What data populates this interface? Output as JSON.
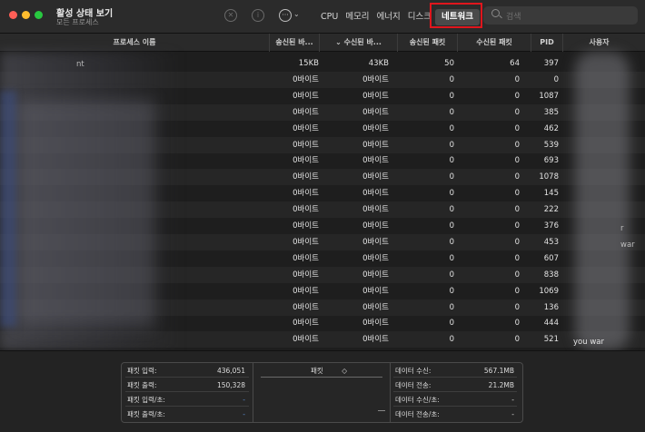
{
  "window": {
    "title": "활성 상태 보기",
    "subtitle": "모든 프로세스"
  },
  "toolbar": {
    "stop_glyph": "✕",
    "info_glyph": "i",
    "more_glyph": "···",
    "chevron_glyph": "⌄"
  },
  "tabs": [
    {
      "label": "CPU",
      "active": false
    },
    {
      "label": "메모리",
      "active": false
    },
    {
      "label": "에너지",
      "active": false
    },
    {
      "label": "디스크",
      "active": false
    },
    {
      "label": "네트워크",
      "active": true
    }
  ],
  "search": {
    "placeholder": "검색"
  },
  "columns": [
    "프로세스 이름",
    "송신된 바...",
    "수신된 바...",
    "송신된 패킷",
    "수신된 패킷",
    "PID",
    "사용자"
  ],
  "sort_indicator": "⌄",
  "rows": [
    {
      "name_fragment": "nt",
      "sent_bytes": "15KB",
      "recv_bytes": "43KB",
      "sent_packets": "50",
      "recv_packets": "64",
      "pid": "397"
    },
    {
      "sent_bytes": "0바이트",
      "recv_bytes": "0바이트",
      "sent_packets": "0",
      "recv_packets": "0",
      "pid": "0"
    },
    {
      "sent_bytes": "0바이트",
      "recv_bytes": "0바이트",
      "sent_packets": "0",
      "recv_packets": "0",
      "pid": "1087"
    },
    {
      "sent_bytes": "0바이트",
      "recv_bytes": "0바이트",
      "sent_packets": "0",
      "recv_packets": "0",
      "pid": "385"
    },
    {
      "sent_bytes": "0바이트",
      "recv_bytes": "0바이트",
      "sent_packets": "0",
      "recv_packets": "0",
      "pid": "462"
    },
    {
      "sent_bytes": "0바이트",
      "recv_bytes": "0바이트",
      "sent_packets": "0",
      "recv_packets": "0",
      "pid": "539"
    },
    {
      "sent_bytes": "0바이트",
      "recv_bytes": "0바이트",
      "sent_packets": "0",
      "recv_packets": "0",
      "pid": "693"
    },
    {
      "sent_bytes": "0바이트",
      "recv_bytes": "0바이트",
      "sent_packets": "0",
      "recv_packets": "0",
      "pid": "1078"
    },
    {
      "sent_bytes": "0바이트",
      "recv_bytes": "0바이트",
      "sent_packets": "0",
      "recv_packets": "0",
      "pid": "145"
    },
    {
      "sent_bytes": "0바이트",
      "recv_bytes": "0바이트",
      "sent_packets": "0",
      "recv_packets": "0",
      "pid": "222"
    },
    {
      "sent_bytes": "0바이트",
      "recv_bytes": "0바이트",
      "sent_packets": "0",
      "recv_packets": "0",
      "pid": "376"
    },
    {
      "sent_bytes": "0바이트",
      "recv_bytes": "0바이트",
      "sent_packets": "0",
      "recv_packets": "0",
      "pid": "453"
    },
    {
      "sent_bytes": "0바이트",
      "recv_bytes": "0바이트",
      "sent_packets": "0",
      "recv_packets": "0",
      "pid": "607"
    },
    {
      "sent_bytes": "0바이트",
      "recv_bytes": "0바이트",
      "sent_packets": "0",
      "recv_packets": "0",
      "pid": "838"
    },
    {
      "sent_bytes": "0바이트",
      "recv_bytes": "0바이트",
      "sent_packets": "0",
      "recv_packets": "0",
      "pid": "1069"
    },
    {
      "sent_bytes": "0바이트",
      "recv_bytes": "0바이트",
      "sent_packets": "0",
      "recv_packets": "0",
      "pid": "136"
    },
    {
      "sent_bytes": "0바이트",
      "recv_bytes": "0바이트",
      "sent_packets": "0",
      "recv_packets": "0",
      "pid": "444"
    },
    {
      "sent_bytes": "0바이트",
      "recv_bytes": "0바이트",
      "sent_packets": "0",
      "recv_packets": "0",
      "pid": "521"
    }
  ],
  "user_fragments": {
    "last_row": "you        war",
    "row11": "r",
    "row12": "war"
  },
  "stats_left": [
    {
      "label": "패킷 입력:",
      "value": "436,051"
    },
    {
      "label": "패킷 출력:",
      "value": "150,328"
    },
    {
      "label": "패킷 입력/초:",
      "value": "-"
    },
    {
      "label": "패킷 출력/초:",
      "value": "-"
    }
  ],
  "graph": {
    "title": "패킷",
    "chevron": "◇"
  },
  "stats_right": [
    {
      "label": "데이터 수신:",
      "value": "567.1MB"
    },
    {
      "label": "데이터 전송:",
      "value": "21.2MB"
    },
    {
      "label": "데이터 수신/초:",
      "value": "-"
    },
    {
      "label": "데이터 전송/초:",
      "value": "-"
    }
  ],
  "colors": {
    "highlight": "#e0161d",
    "window_bg": "#1e1e1e"
  }
}
